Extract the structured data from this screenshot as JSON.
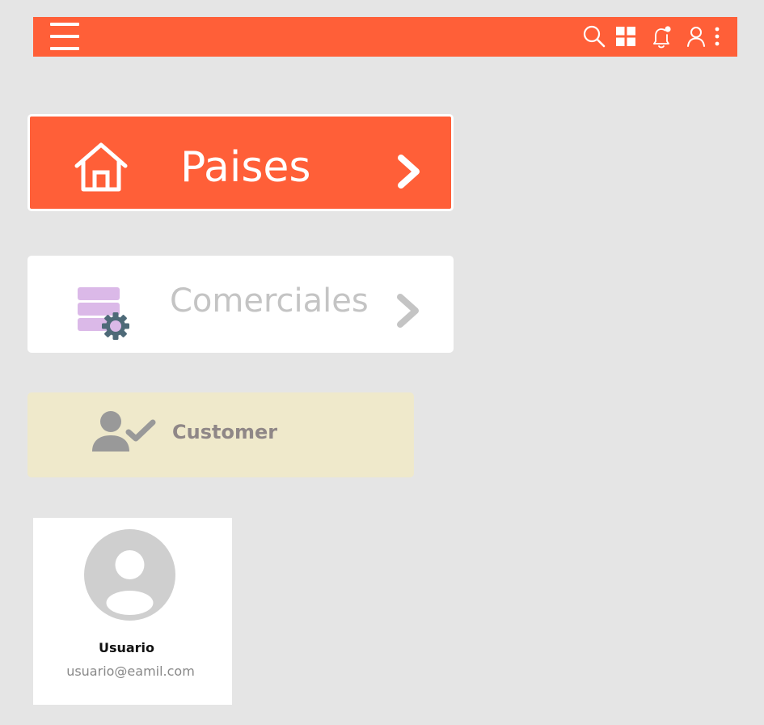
{
  "header": {
    "color": "#ff5f38",
    "icons": [
      "menu-icon",
      "search-icon",
      "apps-grid-icon",
      "notification-bell-icon",
      "user-icon",
      "more-vertical-icon"
    ]
  },
  "menu": {
    "paises": {
      "label": "Paises",
      "icon": "home-icon",
      "bg": "#ff5f38"
    },
    "comerciales": {
      "label": "Comerciales",
      "icon": "database-settings-icon",
      "bg": "#ffffff"
    },
    "customer": {
      "label": "Customer",
      "icon": "user-check-icon",
      "bg": "#efe9cb"
    }
  },
  "profile": {
    "name": "Usuario",
    "email": "usuario@eamil.com",
    "icon": "avatar-icon"
  }
}
